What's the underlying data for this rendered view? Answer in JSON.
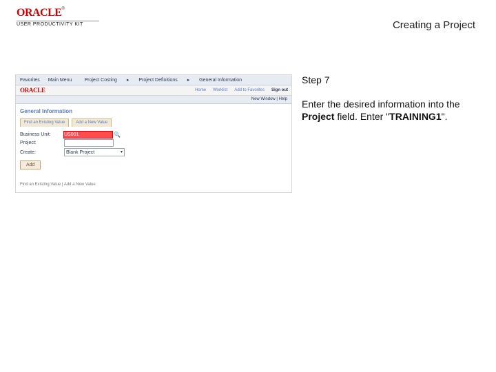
{
  "header": {
    "brand": "ORACLE",
    "trademark": "®",
    "product": "USER PRODUCTIVITY KIT",
    "topic_title": "Creating a Project"
  },
  "instructions": {
    "step_label": "Step 7",
    "line1": "Enter the desired information into the ",
    "field_name": "Project",
    "line2_mid": " field. Enter \"",
    "value": "TRAINING1",
    "line2_end": "\"."
  },
  "screenshot": {
    "nav": {
      "item1": "Favorites",
      "item2": "Main Menu",
      "item3": "Project Costing",
      "chev": "▸",
      "item4": "Project Definitions",
      "item5": "General Information"
    },
    "brand": "ORACLE",
    "links": {
      "home": "Home",
      "worklist": "Worklist",
      "addfav": "Add to Favorites",
      "signout": "Sign out"
    },
    "ribbon": "New Window | Help",
    "section": "General Information",
    "tabs": {
      "t1": "Find an Existing Value",
      "t2": "Add a New Value"
    },
    "rows": {
      "bu_label": "Business Unit:",
      "bu_value": "US001",
      "search_glyph": "🔍",
      "proj_label": "Project:",
      "create_label": "Create:",
      "create_value": "Blank Project",
      "caret": "▾"
    },
    "button": "Add",
    "footer": "Find an Existing Value | Add a New Value"
  }
}
